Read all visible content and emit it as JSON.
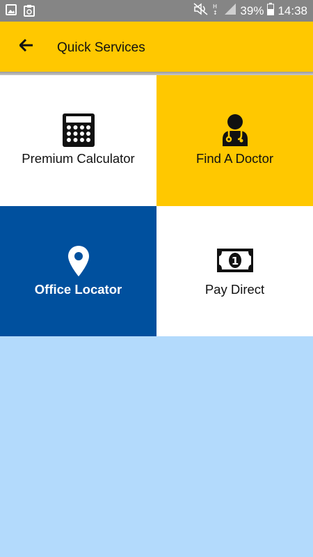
{
  "status_bar": {
    "battery_percent": "39%",
    "time": "14:38",
    "left_icons": [
      "image-icon",
      "clipboard-icon"
    ],
    "right_icons": [
      "mute-icon",
      "data-icon",
      "signal-icon",
      "battery-icon"
    ]
  },
  "header": {
    "title": "Quick Services",
    "back_icon": "arrow-left-icon",
    "color": "#ffc800"
  },
  "tiles": [
    {
      "label": "Premium Calculator",
      "icon": "calculator-icon",
      "background": "#ffffff"
    },
    {
      "label": "Find A Doctor",
      "icon": "doctor-icon",
      "background": "#ffc800"
    },
    {
      "label": "Office Locator",
      "icon": "location-pin-icon",
      "background": "#00509e"
    },
    {
      "label": "Pay Direct",
      "icon": "banknote-icon",
      "background": "#ffffff"
    }
  ],
  "colors": {
    "accent_yellow": "#ffc800",
    "brand_blue": "#00509e",
    "background": "#b3dafc"
  }
}
